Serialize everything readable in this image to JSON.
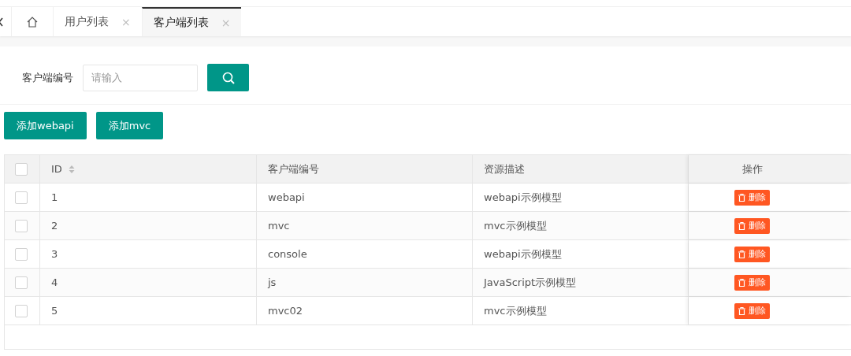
{
  "tabs": [
    {
      "kind": "home",
      "selected": false
    },
    {
      "kind": "page",
      "label": "用户列表",
      "close": "×",
      "selected": false
    },
    {
      "kind": "page",
      "label": "客户端列表",
      "close": "×",
      "selected": true
    }
  ],
  "search": {
    "label": "客户端编号",
    "placeholder": "请输入"
  },
  "toolbar": [
    "添加webapi",
    "添加mvc"
  ],
  "table": {
    "all_checked": false,
    "columns": [
      "ID",
      "客户端编号",
      "资源描述",
      "操作"
    ],
    "rows": [
      {
        "checked": false,
        "cells": [
          "1",
          "webapi",
          "webapi示例模型"
        ],
        "action": "删除"
      },
      {
        "checked": false,
        "cells": [
          "2",
          "mvc",
          "mvc示例模型"
        ],
        "action": "删除"
      },
      {
        "checked": false,
        "cells": [
          "3",
          "console",
          "webapi示例模型"
        ],
        "action": "删除"
      },
      {
        "checked": false,
        "cells": [
          "4",
          "js",
          "JavaScript示例模型"
        ],
        "action": "删除"
      },
      {
        "checked": false,
        "cells": [
          "5",
          "mvc02",
          "mvc示例模型"
        ],
        "action": "删除"
      }
    ]
  }
}
